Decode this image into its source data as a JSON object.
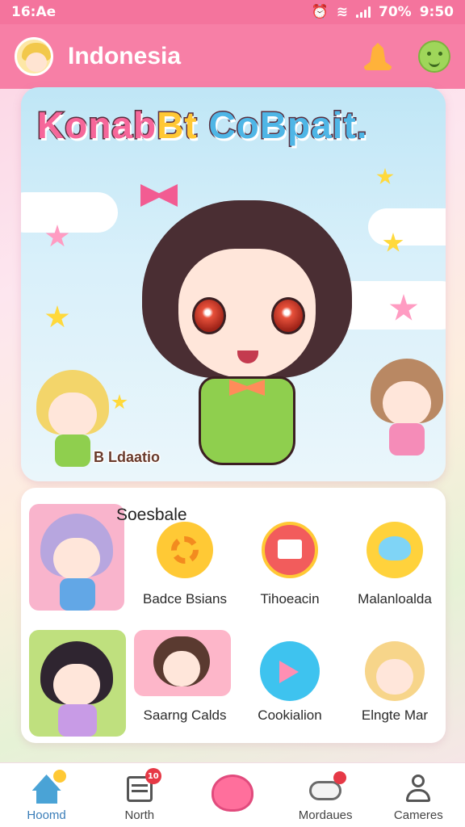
{
  "status": {
    "time": "16:Ae",
    "battery": "70%",
    "clock": "9:50"
  },
  "header": {
    "title": "Indonesia",
    "avatar_icon": "avatar-girl",
    "bell_icon": "bell-icon",
    "emoji_icon": "smiley-icon"
  },
  "hero": {
    "title_part1": "Konab",
    "title_part2": "Bt",
    "title_part3": "CoBpait.",
    "caption": "B Ldaatio"
  },
  "grid": {
    "title": "Soesbale",
    "items": [
      {
        "label": "Badce Bsians",
        "icon": "gear-icon",
        "color": "#ffc935"
      },
      {
        "label": "Tihoeacin",
        "icon": "picture-icon",
        "color": "#f25c5c"
      },
      {
        "label": "Malanloalda",
        "icon": "chat-heart-icon",
        "color": "#ffd23c"
      },
      {
        "label": "Saarng Calds",
        "icon": "character-icon",
        "color": "#fdb6c9"
      },
      {
        "label": "Cookialion",
        "icon": "play-icon",
        "color": "#3ec3ef"
      },
      {
        "label": "Elngte Mar",
        "icon": "cat-character-icon",
        "color": "#f7d58a"
      }
    ]
  },
  "nav": {
    "items": [
      {
        "label": "Hoomd",
        "icon": "home-icon"
      },
      {
        "label": "North",
        "icon": "news-icon",
        "badge": "10"
      },
      {
        "label": "",
        "icon": "heart-icon"
      },
      {
        "label": "Mordaues",
        "icon": "cloud-chat-icon"
      },
      {
        "label": "Cameres",
        "icon": "profile-icon"
      }
    ]
  }
}
